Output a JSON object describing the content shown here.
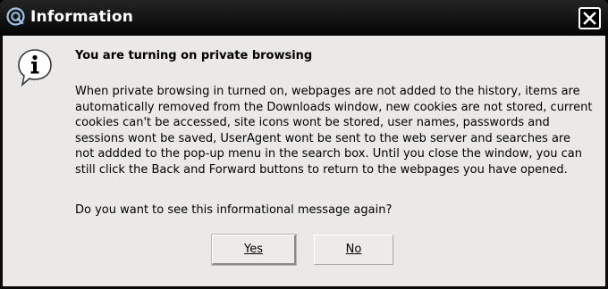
{
  "window": {
    "title": "Information"
  },
  "icons": {
    "app": "app-logo-icon",
    "close": "close-icon",
    "info": "information-icon"
  },
  "dialog": {
    "heading": "You are turning on private browsing",
    "body_lines": [
      "When private browsing in turned on, webpages are not added to the history, items are",
      "automatically removed from the Downloads window, new cookies are not stored, current",
      "cookies can't be accessed, site icons wont be stored, user names, passwords and",
      "sessions wont be saved, UserAgent wont be sent to the web server and searches are",
      "not addded to the pop-up menu in the search box. Until you close the window, you can",
      "still click the Back and Forward buttons to return to the webpages you have opened."
    ],
    "question": "Do you want to see this informational message again?"
  },
  "buttons": {
    "yes_label": "Yes",
    "no_label": "No"
  },
  "colors": {
    "titlebar": "#0a0a0a",
    "client_background": "#eae9e8",
    "title_text": "#ffffff"
  }
}
